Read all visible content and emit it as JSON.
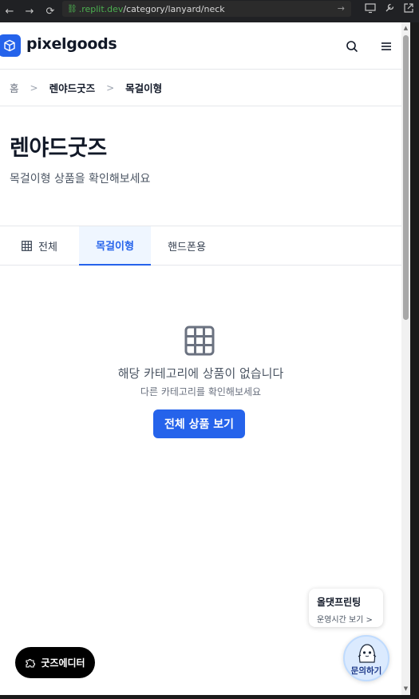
{
  "browser": {
    "url_host": ".replit.dev",
    "url_path": "/category/lanyard/neck"
  },
  "header": {
    "brand": "pixelgoods",
    "logo_icon": "cube-icon",
    "search_icon": "search-icon",
    "menu_icon": "hamburger-menu-icon",
    "accent_color": "#2563eb"
  },
  "breadcrumb": {
    "home": "홈",
    "category": "렌야드굿즈",
    "current": "목걸이형"
  },
  "hero": {
    "title": "렌야드굿즈",
    "subtitle": "목걸이형 상품을 확인해보세요"
  },
  "tabs": [
    {
      "label": "전체",
      "icon": "grid-icon",
      "active": false
    },
    {
      "label": "목걸이형",
      "active": true
    },
    {
      "label": "핸드폰용",
      "active": false
    }
  ],
  "empty_state": {
    "icon": "grid-icon",
    "title": "해당 카테고리에 상품이 없습니다",
    "description": "다른 카테고리를 확인해보세요",
    "button": "전체 상품 보기"
  },
  "chat": {
    "tooltip_title": "올댓프린팅",
    "tooltip_sub": "운영시간 보기 >",
    "button_label": "문의하기"
  },
  "editor": {
    "label": "굿즈에디터",
    "icon": "puzzle-icon"
  }
}
